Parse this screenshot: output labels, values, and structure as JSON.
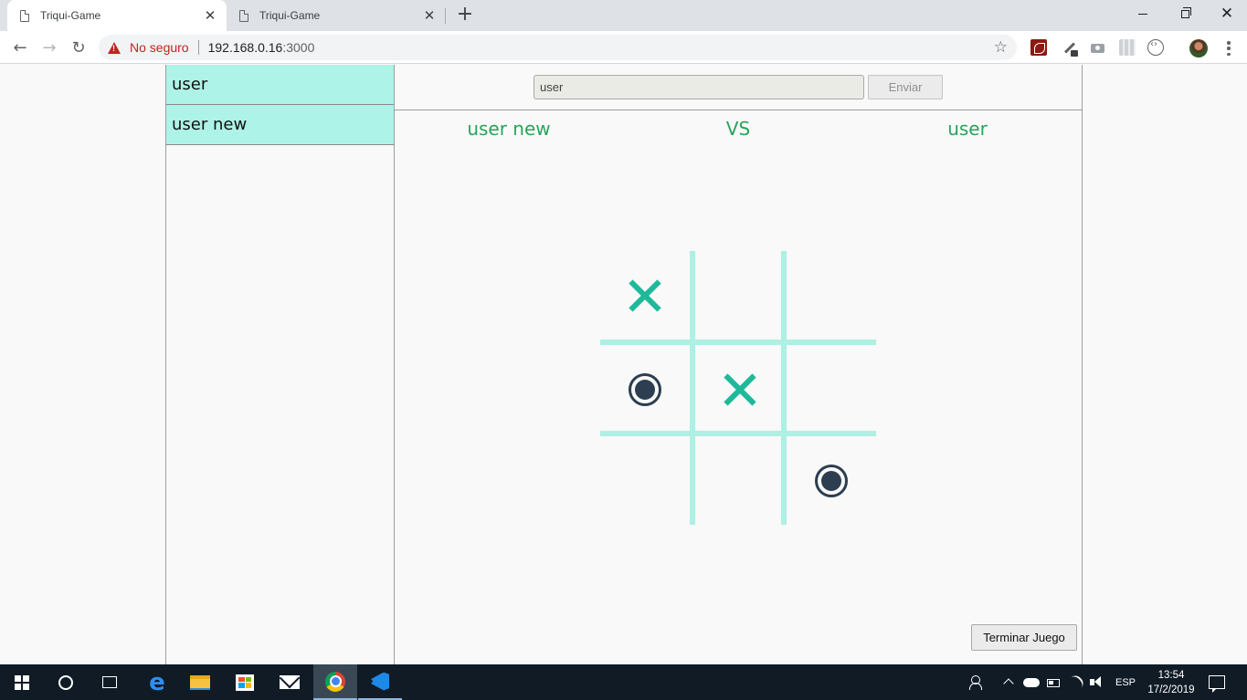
{
  "browser": {
    "tabs": [
      {
        "title": "Triqui-Game",
        "active": true
      },
      {
        "title": "Triqui-Game",
        "active": false
      }
    ],
    "new_tab_label": "+",
    "address": {
      "security_label": "No seguro",
      "host": "192.168.0.16",
      "port": ":3000"
    }
  },
  "sidebar": {
    "users": [
      "user",
      "user new"
    ]
  },
  "message_bar": {
    "input_value": "user",
    "send_label": "Enviar"
  },
  "match": {
    "player_left": "user new",
    "vs_label": "VS",
    "player_right": "user"
  },
  "board": {
    "cells": [
      "X",
      "",
      "",
      "O",
      "X",
      "",
      "",
      "",
      "O"
    ],
    "colors": {
      "x": "#1fb99a",
      "o": "#2c3e50",
      "grid": "#aef0e3"
    }
  },
  "end_button_label": "Terminar Juego",
  "taskbar": {
    "apps": [
      "start-icon",
      "search-icon",
      "task-view-icon",
      "edge-icon",
      "file-explorer-icon",
      "store-icon",
      "mail-icon",
      "chrome-icon",
      "vscode-icon"
    ],
    "language": "ESP",
    "time": "13:54",
    "date": "17/2/2019"
  },
  "colors": {
    "sidebar_item_bg": "#aef3e7",
    "player_text": "#2aa35a",
    "not_secure": "#c5221f"
  }
}
